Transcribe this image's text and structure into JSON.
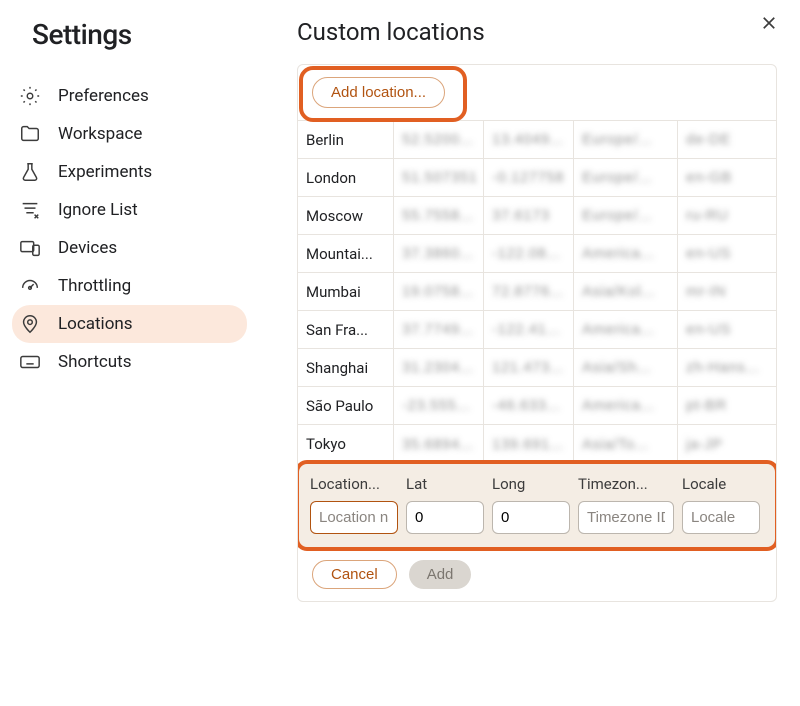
{
  "sidebar": {
    "title": "Settings",
    "items": [
      {
        "label": "Preferences",
        "icon": "gear-icon"
      },
      {
        "label": "Workspace",
        "icon": "folder-icon"
      },
      {
        "label": "Experiments",
        "icon": "flask-icon"
      },
      {
        "label": "Ignore List",
        "icon": "filter-x-icon"
      },
      {
        "label": "Devices",
        "icon": "devices-icon"
      },
      {
        "label": "Throttling",
        "icon": "gauge-icon"
      },
      {
        "label": "Locations",
        "icon": "pin-icon",
        "active": true
      },
      {
        "label": "Shortcuts",
        "icon": "keyboard-icon"
      }
    ]
  },
  "main": {
    "title": "Custom locations",
    "add_location_label": "Add location...",
    "locations": [
      {
        "name": "Berlin",
        "lat": "52.5200...",
        "long": "13.4049...",
        "tz": "Europe/...",
        "locale": "de-DE"
      },
      {
        "name": "London",
        "lat": "51.507351",
        "long": "-0.127758",
        "tz": "Europe/...",
        "locale": "en-GB"
      },
      {
        "name": "Moscow",
        "lat": "55.7558...",
        "long": "37.6173",
        "tz": "Europe/...",
        "locale": "ru-RU"
      },
      {
        "name": "Mountai...",
        "lat": "37.3860...",
        "long": "-122.08...",
        "tz": "America...",
        "locale": "en-US"
      },
      {
        "name": "Mumbai",
        "lat": "19.0758...",
        "long": "72.8776...",
        "tz": "Asia/Kol...",
        "locale": "mr-IN"
      },
      {
        "name": "San Fra...",
        "lat": "37.7749...",
        "long": "-122.41...",
        "tz": "America...",
        "locale": "en-US"
      },
      {
        "name": "Shanghai",
        "lat": "31.2304...",
        "long": "121.473...",
        "tz": "Asia/Sh...",
        "locale": "zh-Hans..."
      },
      {
        "name": "São Paulo",
        "lat": "-23.555...",
        "long": "-46.633...",
        "tz": "America...",
        "locale": "pt-BR"
      },
      {
        "name": "Tokyo",
        "lat": "35.6894...",
        "long": "139.691...",
        "tz": "Asia/To...",
        "locale": "ja-JP"
      }
    ],
    "edit": {
      "headers": {
        "name": "Location...",
        "lat": "Lat",
        "long": "Long",
        "tz": "Timezon...",
        "locale": "Locale"
      },
      "placeholders": {
        "name": "Location name",
        "tz": "Timezone ID",
        "locale": "Locale"
      },
      "values": {
        "lat": "0",
        "long": "0"
      }
    },
    "footer": {
      "cancel": "Cancel",
      "add": "Add"
    }
  }
}
